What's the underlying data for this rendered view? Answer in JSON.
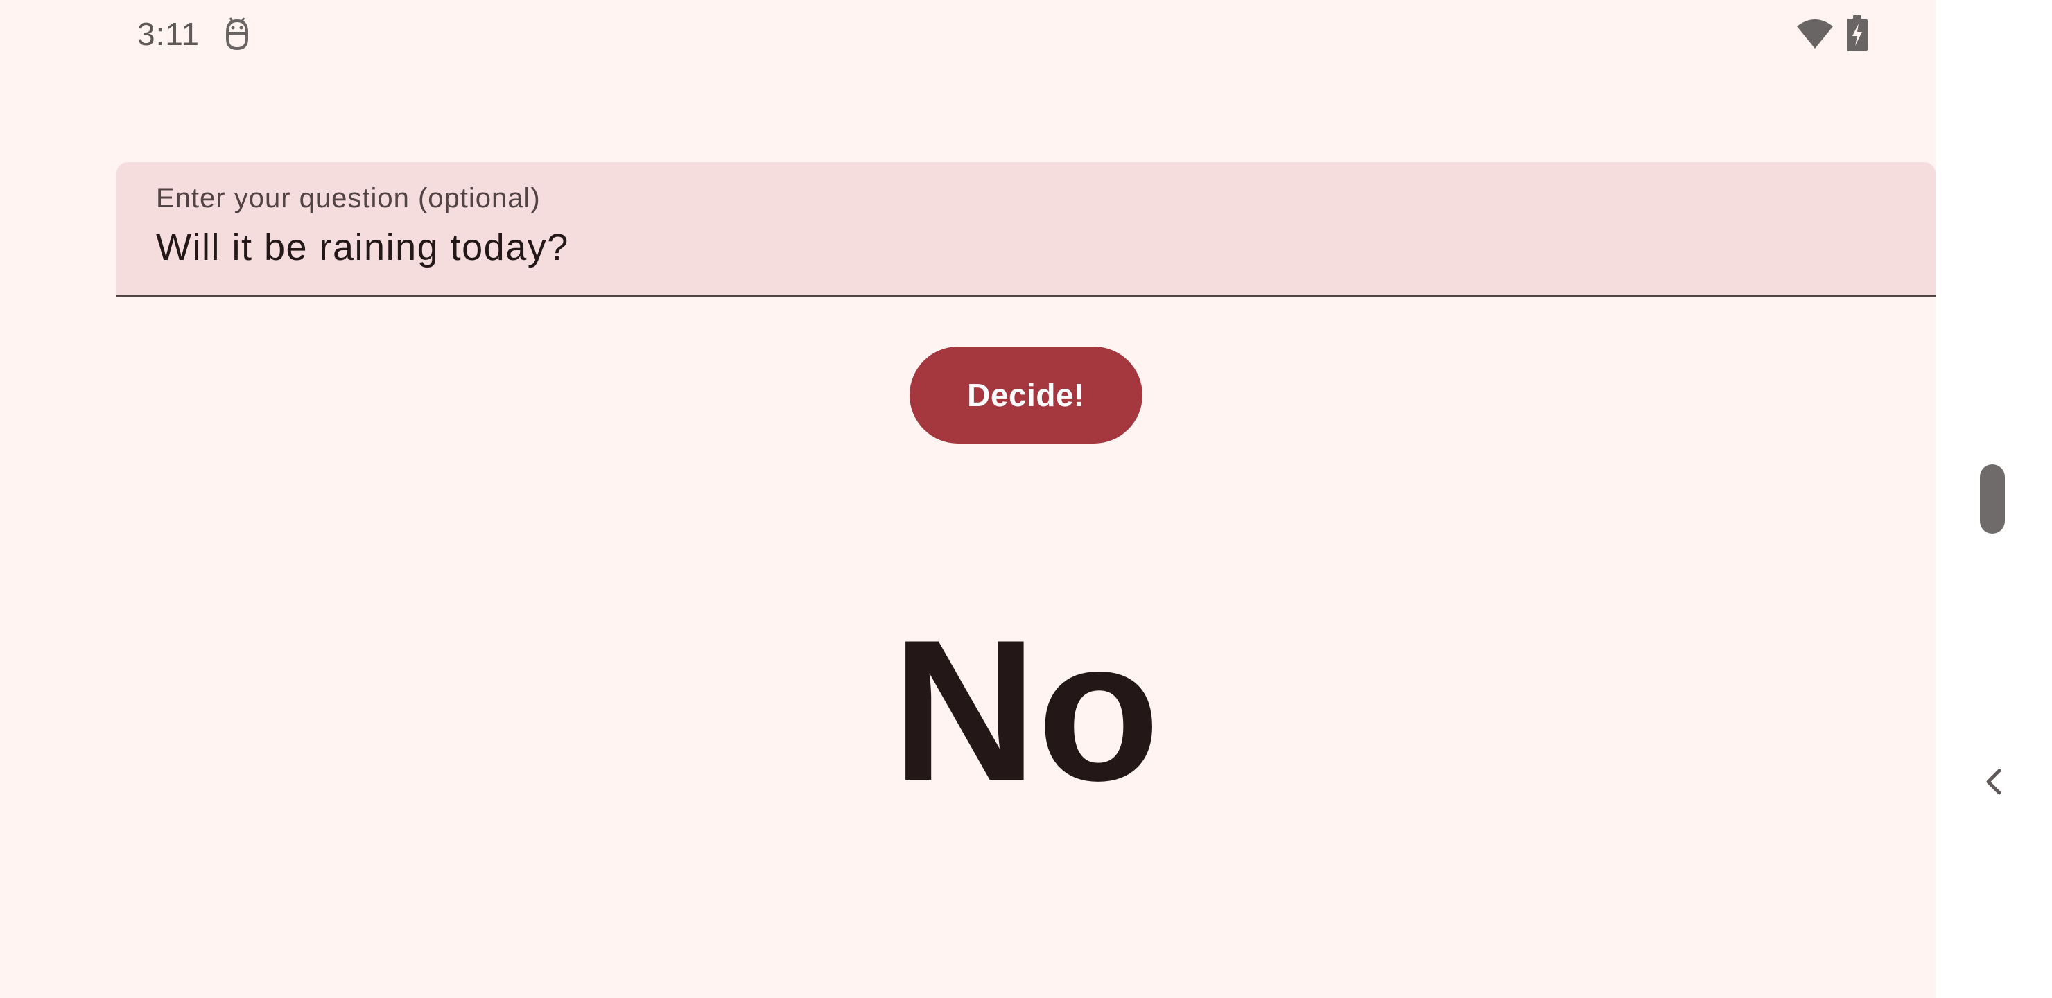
{
  "status_bar": {
    "time": "3:11",
    "notification_icon": "android-face-icon",
    "wifi_icon": "wifi-icon",
    "battery_icon": "battery-charging-icon"
  },
  "question_field": {
    "label": "Enter your question (optional)",
    "value": "Will it be raining today?"
  },
  "decide_button": {
    "label": "Decide!"
  },
  "answer": {
    "text": "No"
  },
  "nav": {
    "back_icon": "chevron-left-icon"
  },
  "colors": {
    "background": "#fff4f2",
    "field_background": "#f5dcdd",
    "accent": "#a5373f",
    "text_primary": "#231718",
    "text_secondary": "#524345"
  }
}
